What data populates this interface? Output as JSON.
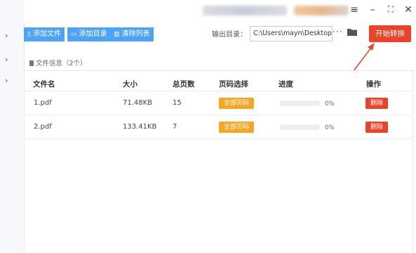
{
  "toolbar": {
    "add_file": "添加文件",
    "add_folder": "添加目录",
    "clear_list": "清除列表",
    "output_label": "输出目录：",
    "output_path": "C:\\Users\\mayn\\Desktop",
    "more": "···",
    "start": "开始转换"
  },
  "file_info": "文件信息（2个）",
  "table": {
    "headers": [
      "文件名",
      "大小",
      "总页数",
      "页码选择",
      "进度",
      "操作"
    ],
    "rows": [
      {
        "name": "1.pdf",
        "size": "71.48KB",
        "pages": "15",
        "page_select": "全部页码",
        "progress": 0,
        "progress_label": "0%",
        "action": "删除"
      },
      {
        "name": "2.pdf",
        "size": "133.41KB",
        "pages": "7",
        "page_select": "全部页码",
        "progress": 0,
        "progress_label": "0%",
        "action": "删除"
      }
    ]
  },
  "window_controls": [
    "≡",
    "–",
    "⛶",
    "✕"
  ],
  "icons": [
    "file-icon",
    "folder-icon",
    "trash-icon",
    "folder-open-icon",
    "document-icon",
    "menu-icon",
    "minimize-icon",
    "fullscreen-icon",
    "close-icon"
  ],
  "colors": {
    "accent_blue": "#4ca3f7",
    "start_red": "#e9442a",
    "orange": "#f5a623",
    "annotation_arrow": "#e24a33"
  }
}
